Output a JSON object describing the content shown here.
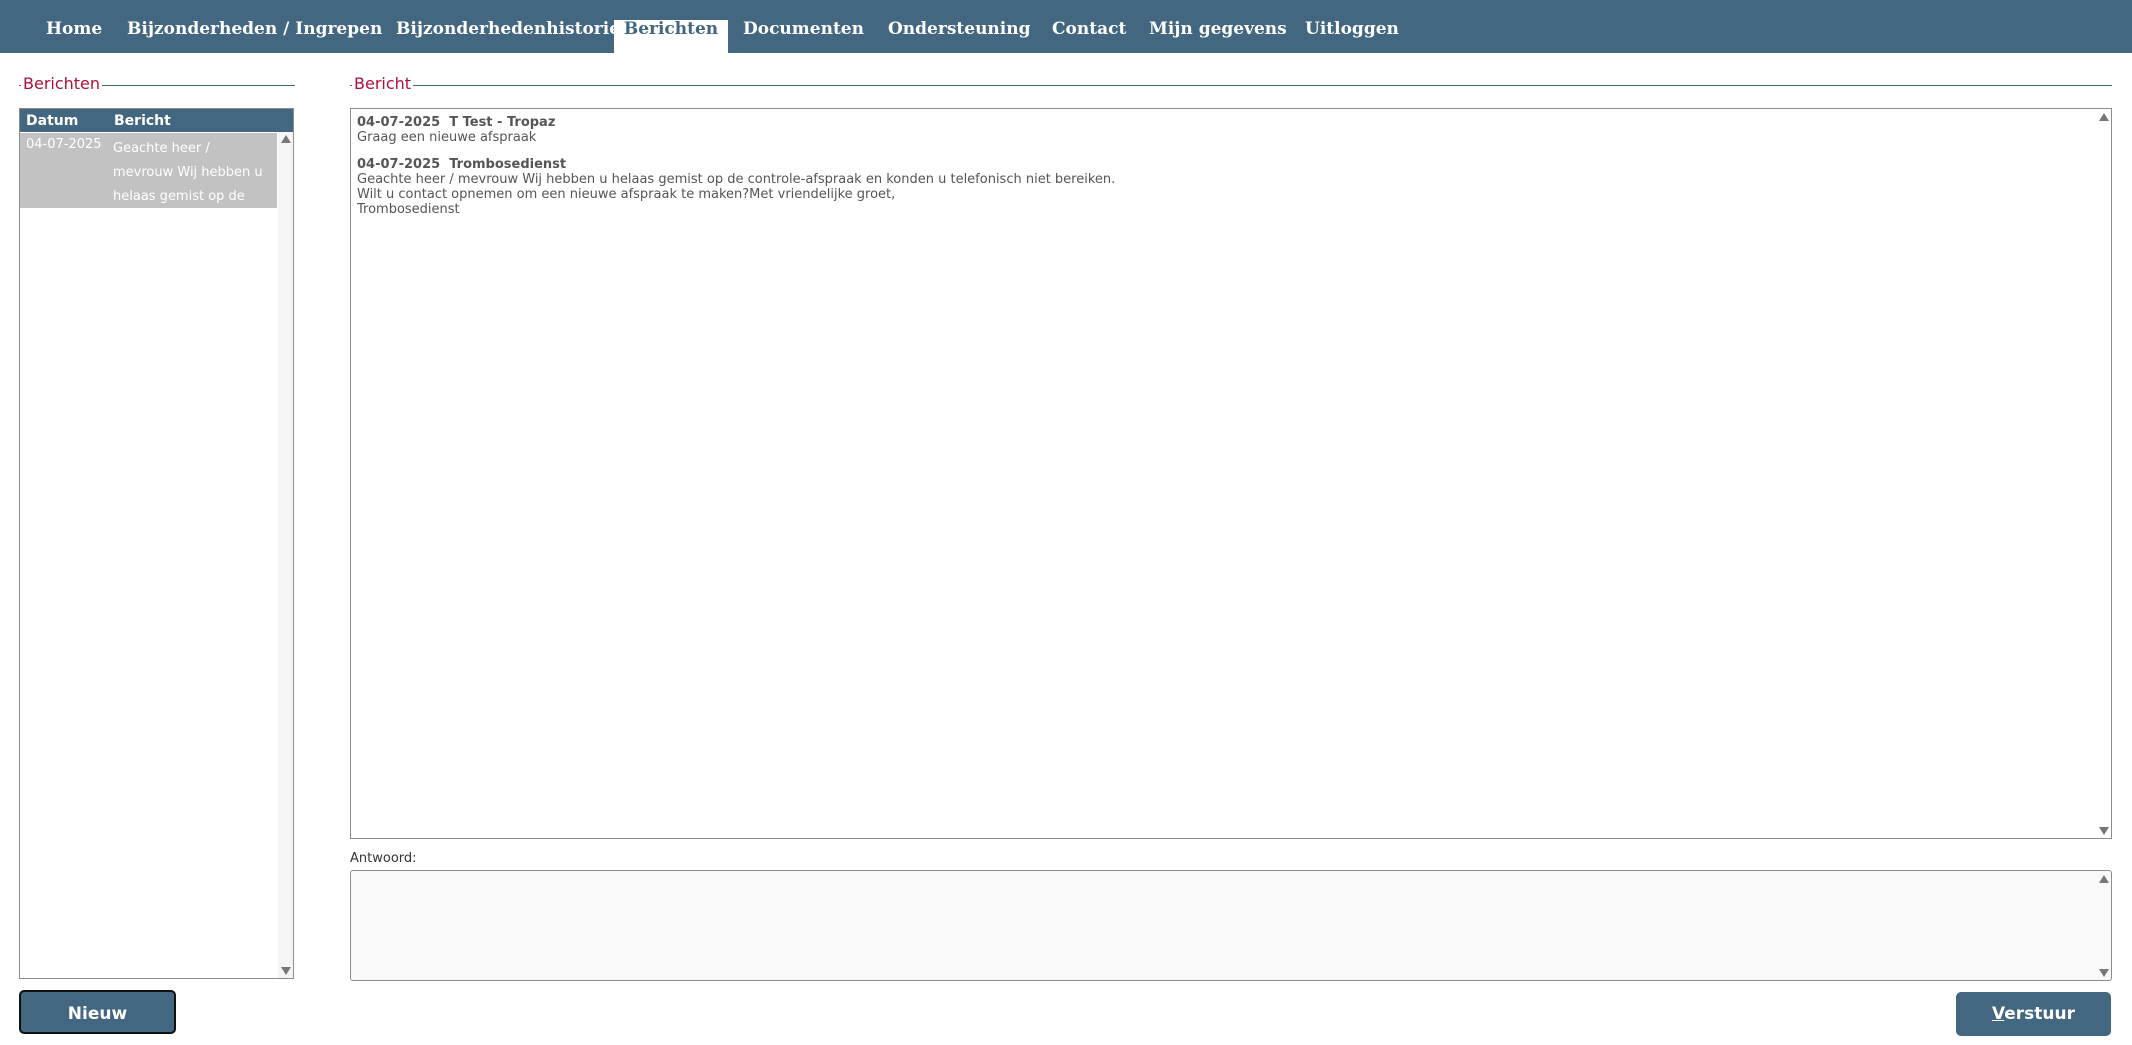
{
  "nav": {
    "items": [
      {
        "label": "Home"
      },
      {
        "label": "Bijzonderheden / Ingrepen"
      },
      {
        "label": "Bijzonderhedenhistorie"
      },
      {
        "label": "Berichten"
      },
      {
        "label": "Documenten"
      },
      {
        "label": "Ondersteuning"
      },
      {
        "label": "Contact"
      },
      {
        "label": "Mijn gegevens"
      },
      {
        "label": "Uitloggen"
      }
    ],
    "active": "Berichten"
  },
  "list": {
    "legend": "Berichten",
    "headers": {
      "date": "Datum",
      "message": "Bericht"
    },
    "rows": [
      {
        "date": "04-07-2025",
        "message": "Geachte heer / mevrouw Wij hebben u helaas gemist op de controle-"
      }
    ]
  },
  "message": {
    "legend": "Bericht",
    "entries": [
      {
        "date": "04-07-2025",
        "sender": "T Test - Tropaz",
        "lines": [
          "Graag een nieuwe afspraak"
        ]
      },
      {
        "date": "04-07-2025",
        "sender": "Trombosedienst",
        "lines": [
          "Geachte heer / mevrouw Wij hebben u helaas gemist op de controle-afspraak en konden u telefonisch niet bereiken.",
          "Wilt u contact opnemen om een nieuwe afspraak te maken?Met vriendelijke groet,",
          "Trombosedienst"
        ]
      }
    ]
  },
  "reply": {
    "label": "Antwoord:",
    "value": ""
  },
  "buttons": {
    "new": "Nieuw",
    "send_first": "V",
    "send_rest": "erstuur"
  },
  "colors": {
    "nav_bg": "#446781",
    "legend": "#b0103a",
    "row_selected": "#c2c2c2"
  }
}
